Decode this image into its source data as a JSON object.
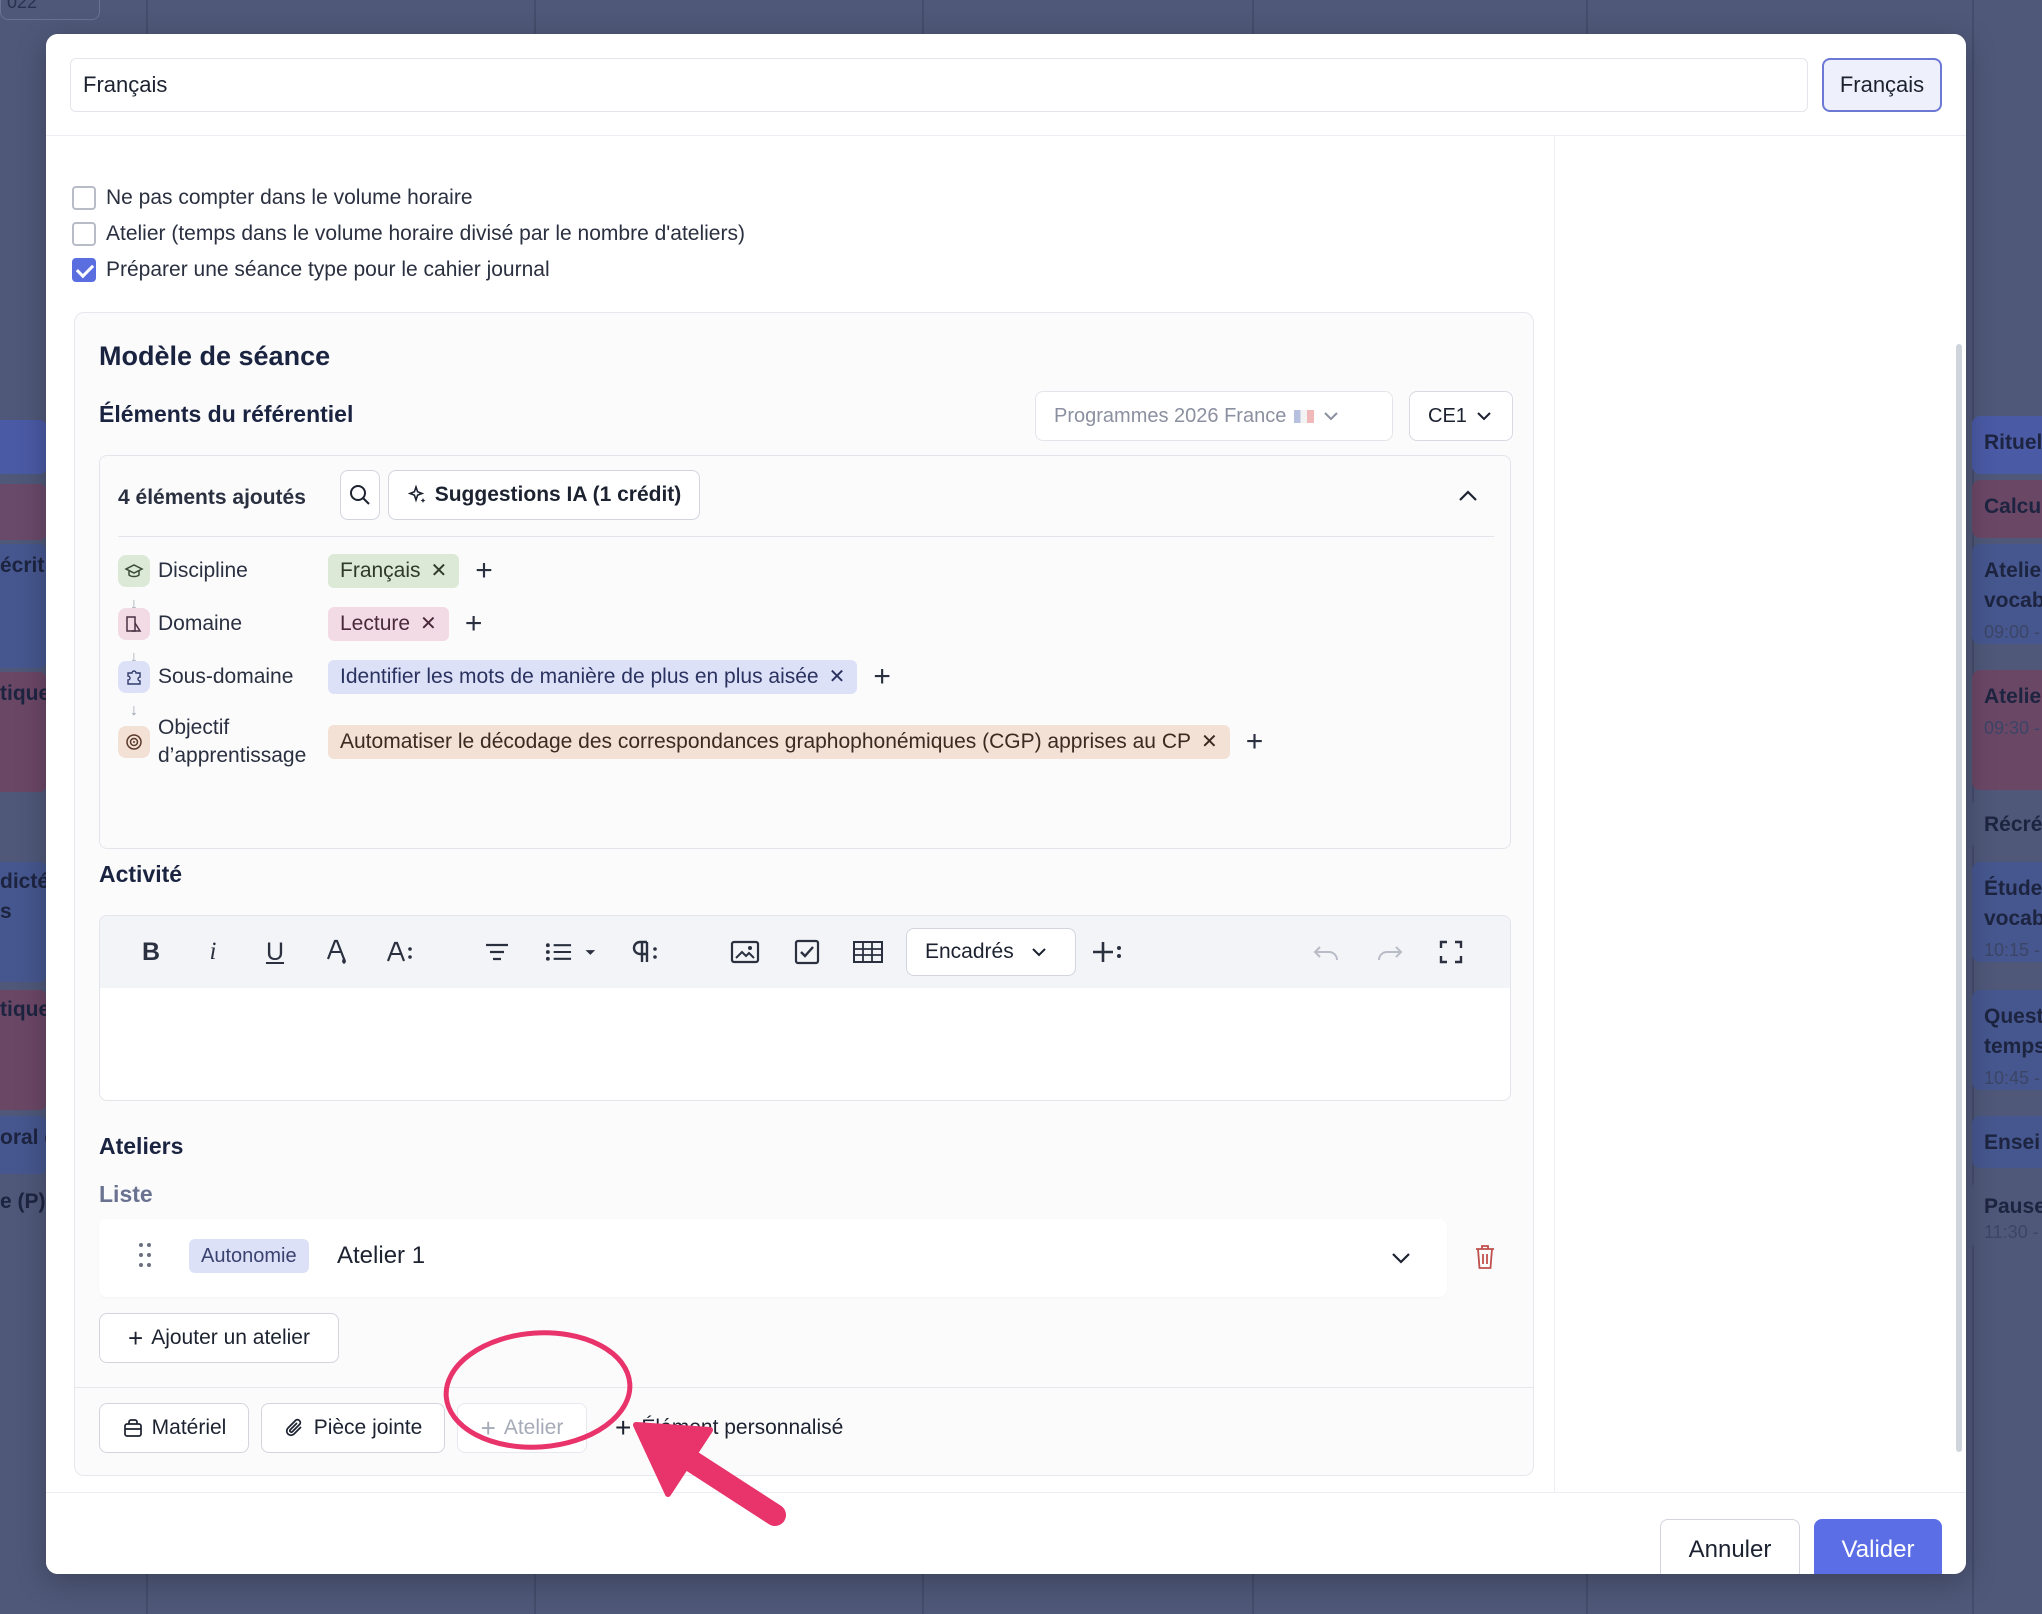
{
  "background": {
    "top_left_fragment": "022",
    "left_fragments": [
      "écrit",
      "tique",
      "dicté",
      "s",
      "tique",
      "oral e",
      "e (P)"
    ],
    "right_cards": [
      {
        "title": "Rituel",
        "time": ""
      },
      {
        "title": "Calcu",
        "time": ""
      },
      {
        "title": "Atelie vocab",
        "time": "09:00 -"
      },
      {
        "title": "Atelie",
        "time": "09:30 -"
      },
      {
        "title": "Récré",
        "time": ""
      },
      {
        "title": "Étude vocab",
        "time": "10:15 -"
      },
      {
        "title": "Quest temps",
        "time": "10:45 -"
      },
      {
        "title": "Ensei",
        "time": ""
      },
      {
        "title": "Pause",
        "time": "11:30 -"
      }
    ]
  },
  "modal": {
    "title_value": "Français",
    "language_button": "Français",
    "checkboxes": [
      {
        "label": "Ne pas compter dans le volume horaire",
        "checked": false
      },
      {
        "label": "Atelier (temps dans le volume horaire divisé par le nombre d'ateliers)",
        "checked": false
      },
      {
        "label": "Préparer une séance type pour le cahier journal",
        "checked": true
      }
    ],
    "model": {
      "heading": "Modèle de séance",
      "referentiel_heading": "Éléments du référentiel",
      "program_select": "Programmes 2026 France",
      "level_select": "CE1",
      "added_count": "4 éléments ajoutés",
      "ai_suggestions": "Suggestions IA (1 crédit)",
      "rows": [
        {
          "label": "Discipline",
          "tag": "Français"
        },
        {
          "label": "Domaine",
          "tag": "Lecture"
        },
        {
          "label": "Sous-domaine",
          "tag": "Identifier les mots de manière de plus en plus aisée"
        },
        {
          "label": "Objectif d’apprentissage",
          "tag": "Automatiser le décodage des correspondances graphophonémiques (CGP) apprises au CP"
        }
      ],
      "activity_heading": "Activité",
      "toolbar": {
        "bold": "B",
        "italic": "i",
        "underline": "U",
        "boxes_select": "Encadrés"
      },
      "ateliers_heading": "Ateliers",
      "list_heading": "Liste",
      "atelier_badge": "Autonomie",
      "atelier_name": "Atelier 1",
      "add_atelier": "Ajouter un atelier",
      "footer_buttons": {
        "materiel": "Matériel",
        "piece_jointe": "Pièce jointe",
        "atelier": "Atelier",
        "element_perso": "Élément personnalisé"
      }
    },
    "actions": {
      "cancel": "Annuler",
      "validate": "Valider"
    }
  },
  "colors": {
    "accent": "#5b6ee6",
    "annotation": "#e8336b",
    "tag_discipline": "#dbe9d6",
    "tag_domaine": "#f3dbe6",
    "tag_sous_domaine": "#dde1f8",
    "tag_objectif": "#f3e1d6"
  }
}
